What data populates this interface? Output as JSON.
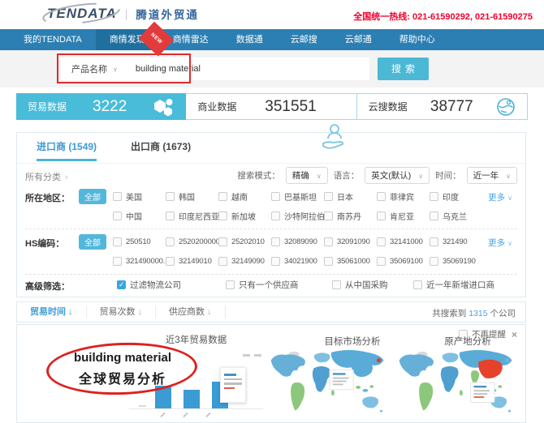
{
  "header": {
    "logo": "TENDATA",
    "divider": "|",
    "product_name": "腾道外贸通",
    "hotline": "全国统一热线: 021-61590292, 021-61590275"
  },
  "nav": {
    "items": [
      {
        "label": "我的TENDATA",
        "active": false
      },
      {
        "label": "商情发现",
        "active": true,
        "badge": "NEW"
      },
      {
        "label": "商情雷达",
        "active": false
      },
      {
        "label": "数据通",
        "active": false
      },
      {
        "label": "云邮搜",
        "active": false
      },
      {
        "label": "云邮通",
        "active": false
      },
      {
        "label": "帮助中心",
        "active": false
      }
    ]
  },
  "search": {
    "category": "产品名称",
    "query": "building material",
    "button_label": "搜索"
  },
  "data_tabs": [
    {
      "label": "贸易数据",
      "count": "3222",
      "icon": "molecule-icon",
      "active": true
    },
    {
      "label": "商业数据",
      "count": "351551",
      "icon": "",
      "active": false
    },
    {
      "label": "云搜数据",
      "count": "38777",
      "icon": "globe-icon",
      "active": false
    }
  ],
  "trader_tabs": [
    {
      "label": "进口商",
      "count": "(1549)",
      "active": true
    },
    {
      "label": "出口商",
      "count": "(1673)",
      "active": false
    }
  ],
  "filter_bar": {
    "all_categories": "所有分类",
    "search_mode_label": "搜索模式：",
    "search_mode_value": "精确",
    "language_label": "语言：",
    "language_value": "英文(默认)",
    "time_label": "时间：",
    "time_value": "近一年"
  },
  "filters": {
    "region": {
      "label": "所在地区：",
      "all_badge": "全部",
      "more": "更多",
      "row1": [
        "美国",
        "韩国",
        "越南",
        "巴基斯坦",
        "日本",
        "菲律宾",
        "印度"
      ],
      "row2": [
        "中国",
        "印度尼西亚",
        "新加坡",
        "沙特阿拉伯",
        "南苏丹",
        "肯尼亚",
        "乌克兰"
      ]
    },
    "hs_code": {
      "label": "HS编码：",
      "all_badge": "全部",
      "more": "更多",
      "row1": [
        "250510",
        "2520200000",
        "25202010",
        "32089090",
        "32091090",
        "32141000",
        "321490"
      ],
      "row2": [
        "321490000...",
        "32149010",
        "32149090",
        "34021900",
        "35061000",
        "35069100",
        "35069190"
      ]
    },
    "advanced": {
      "label": "高级筛选：",
      "options": [
        {
          "label": "过滤物流公司",
          "checked": true
        },
        {
          "label": "只有一个供应商",
          "checked": false
        },
        {
          "label": "从中国采购",
          "checked": false
        },
        {
          "label": "近一年新增进口商",
          "checked": false
        }
      ]
    }
  },
  "sort_bar": {
    "options": [
      {
        "label": "贸易时间",
        "active": true
      },
      {
        "label": "贸易次数",
        "active": false
      },
      {
        "label": "供应商数",
        "active": false
      }
    ],
    "result_prefix": "共搜索到",
    "result_count": "1315",
    "result_suffix": "个公司"
  },
  "report": {
    "dismiss_label": "不再提醒",
    "close": "×",
    "headline_line1": "building material",
    "headline_line2": "全球贸易分析",
    "charts": [
      {
        "title": "近3年贸易数据"
      },
      {
        "title": "目标市场分析"
      },
      {
        "title": "原产地分析"
      }
    ]
  },
  "chart_data": [
    {
      "type": "bar",
      "title": "近3年贸易数据",
      "values_percent_of_plot": [
        45,
        37,
        52
      ],
      "bar_color": "#3a9bd5",
      "legend_position": "top-right",
      "tick_labels_legible": false
    },
    {
      "type": "map",
      "title": "目标市场分析"
    },
    {
      "type": "map",
      "title": "原产地分析",
      "highlight": "China shown in red"
    }
  ],
  "colors": {
    "nav_blue": "#2b7fb2",
    "accent_cyan": "#49bcd9",
    "link_blue": "#4ba3e3",
    "hotline_red": "#f0002d",
    "annotation_red": "#e02b2b"
  }
}
